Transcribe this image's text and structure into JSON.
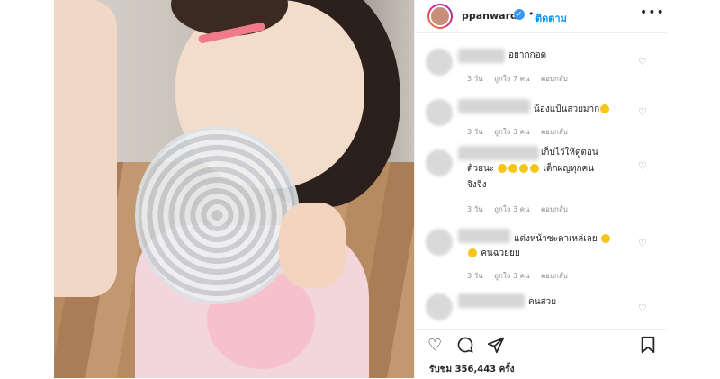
{
  "post": {
    "username": "ppanward",
    "follow_label": "ติดตาม",
    "more_label": "•••",
    "separator": "•",
    "verified_glyph": "✓"
  },
  "comments": [
    {
      "text": "อยากกอด",
      "time": "3 วัน",
      "likes": "ถูกใจ 7 คน",
      "reply": "ตอบกลับ"
    },
    {
      "text": "น้องแป้นสวยมาก",
      "time": "3 วัน",
      "likes": "ถูกใจ 3 คน",
      "reply": "ตอบกลับ"
    },
    {
      "text_line1": "เก็บไว้ให้ดูตอน",
      "text_line2": "ด้วยนะ",
      "text_line2b": "เด็กผญทุกคน",
      "text_line3": "จิงจิง",
      "time": "3 วัน",
      "likes": "ถูกใจ 3 คน",
      "reply": "ตอบกลับ"
    },
    {
      "text_line1": "แต่งหน้าซะตาเหล่เลย",
      "text_line2": "คนฉวยยย",
      "time": "3 วัน",
      "likes": "ถูกใจ 3 คน",
      "reply": "ตอบกลับ"
    },
    {
      "text": "คนสวย"
    }
  ],
  "actions": {
    "like_icon": "heart-icon",
    "comment_icon": "comment-icon",
    "share_icon": "share-icon",
    "save_icon": "bookmark-icon"
  },
  "views_label": "รับชม 356,443 ครั้ง",
  "colors": {
    "accent": "#0095f6",
    "verified": "#3897f0",
    "meta": "#8e8e8e"
  }
}
